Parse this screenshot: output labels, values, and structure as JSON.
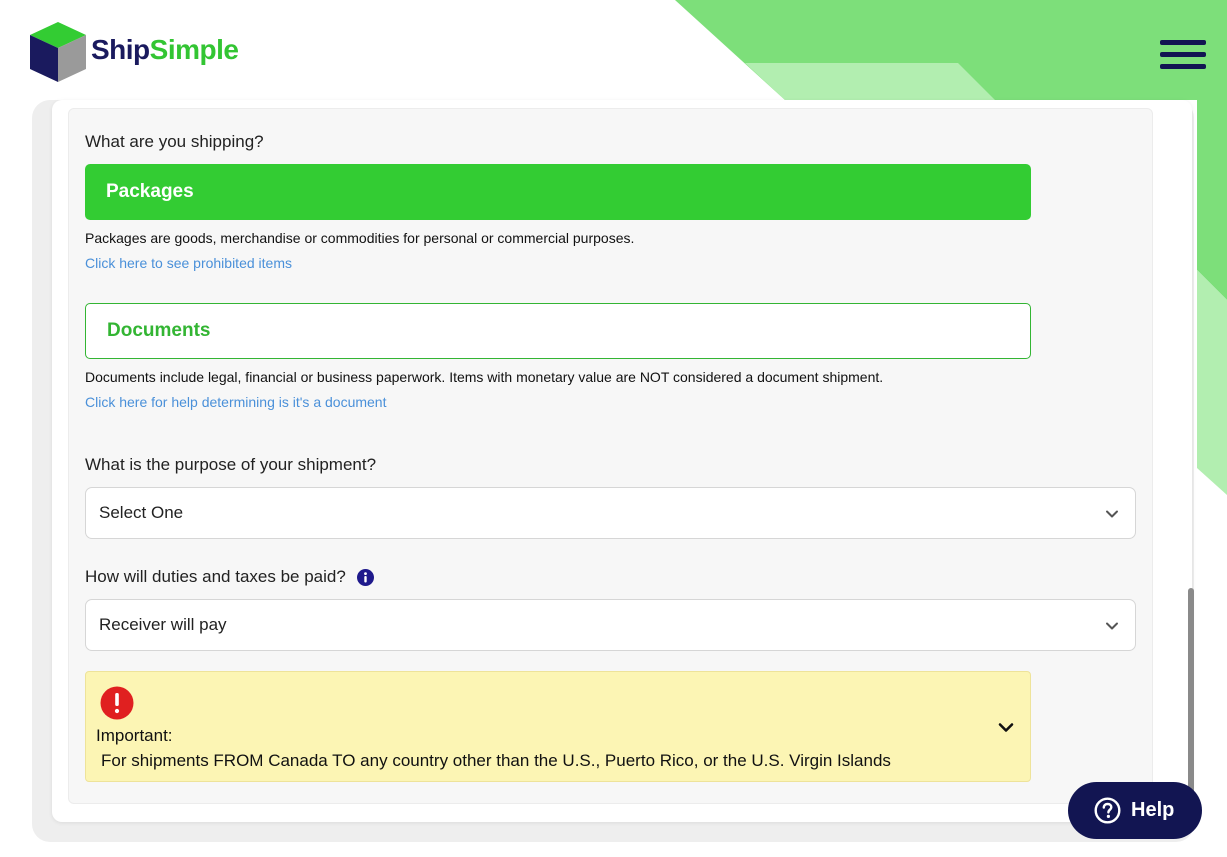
{
  "header": {
    "logo": {
      "part1": "Ship",
      "part2": "Simple"
    },
    "menu_icon": "hamburger-menu-icon"
  },
  "form": {
    "shipping_question": "What are you shipping?",
    "options": [
      {
        "label": "Packages",
        "selected": true,
        "description": "Packages are goods, merchandise or commodities for personal or commercial purposes.",
        "link": "Click here to see prohibited items"
      },
      {
        "label": "Documents",
        "selected": false,
        "description": "Documents include legal, financial or business paperwork. Items with monetary value are NOT considered a document shipment.",
        "link": "Click here for help determining is it's a document"
      }
    ],
    "purpose_question": "What is the purpose of your shipment?",
    "purpose_value": "Select One",
    "duties_question": "How will duties and taxes be paid?",
    "duties_value": "Receiver will pay"
  },
  "alert": {
    "title": "Important:",
    "text": "For shipments FROM Canada TO any country other than the U.S., Puerto Rico, or the U.S. Virgin Islands"
  },
  "help_button": {
    "label": "Help"
  },
  "colors": {
    "brand_green": "#33cc33",
    "brand_navy": "#121552",
    "link_blue": "#4a90d9",
    "alert_bg": "#fcf5b4",
    "alert_red": "#e02020"
  }
}
